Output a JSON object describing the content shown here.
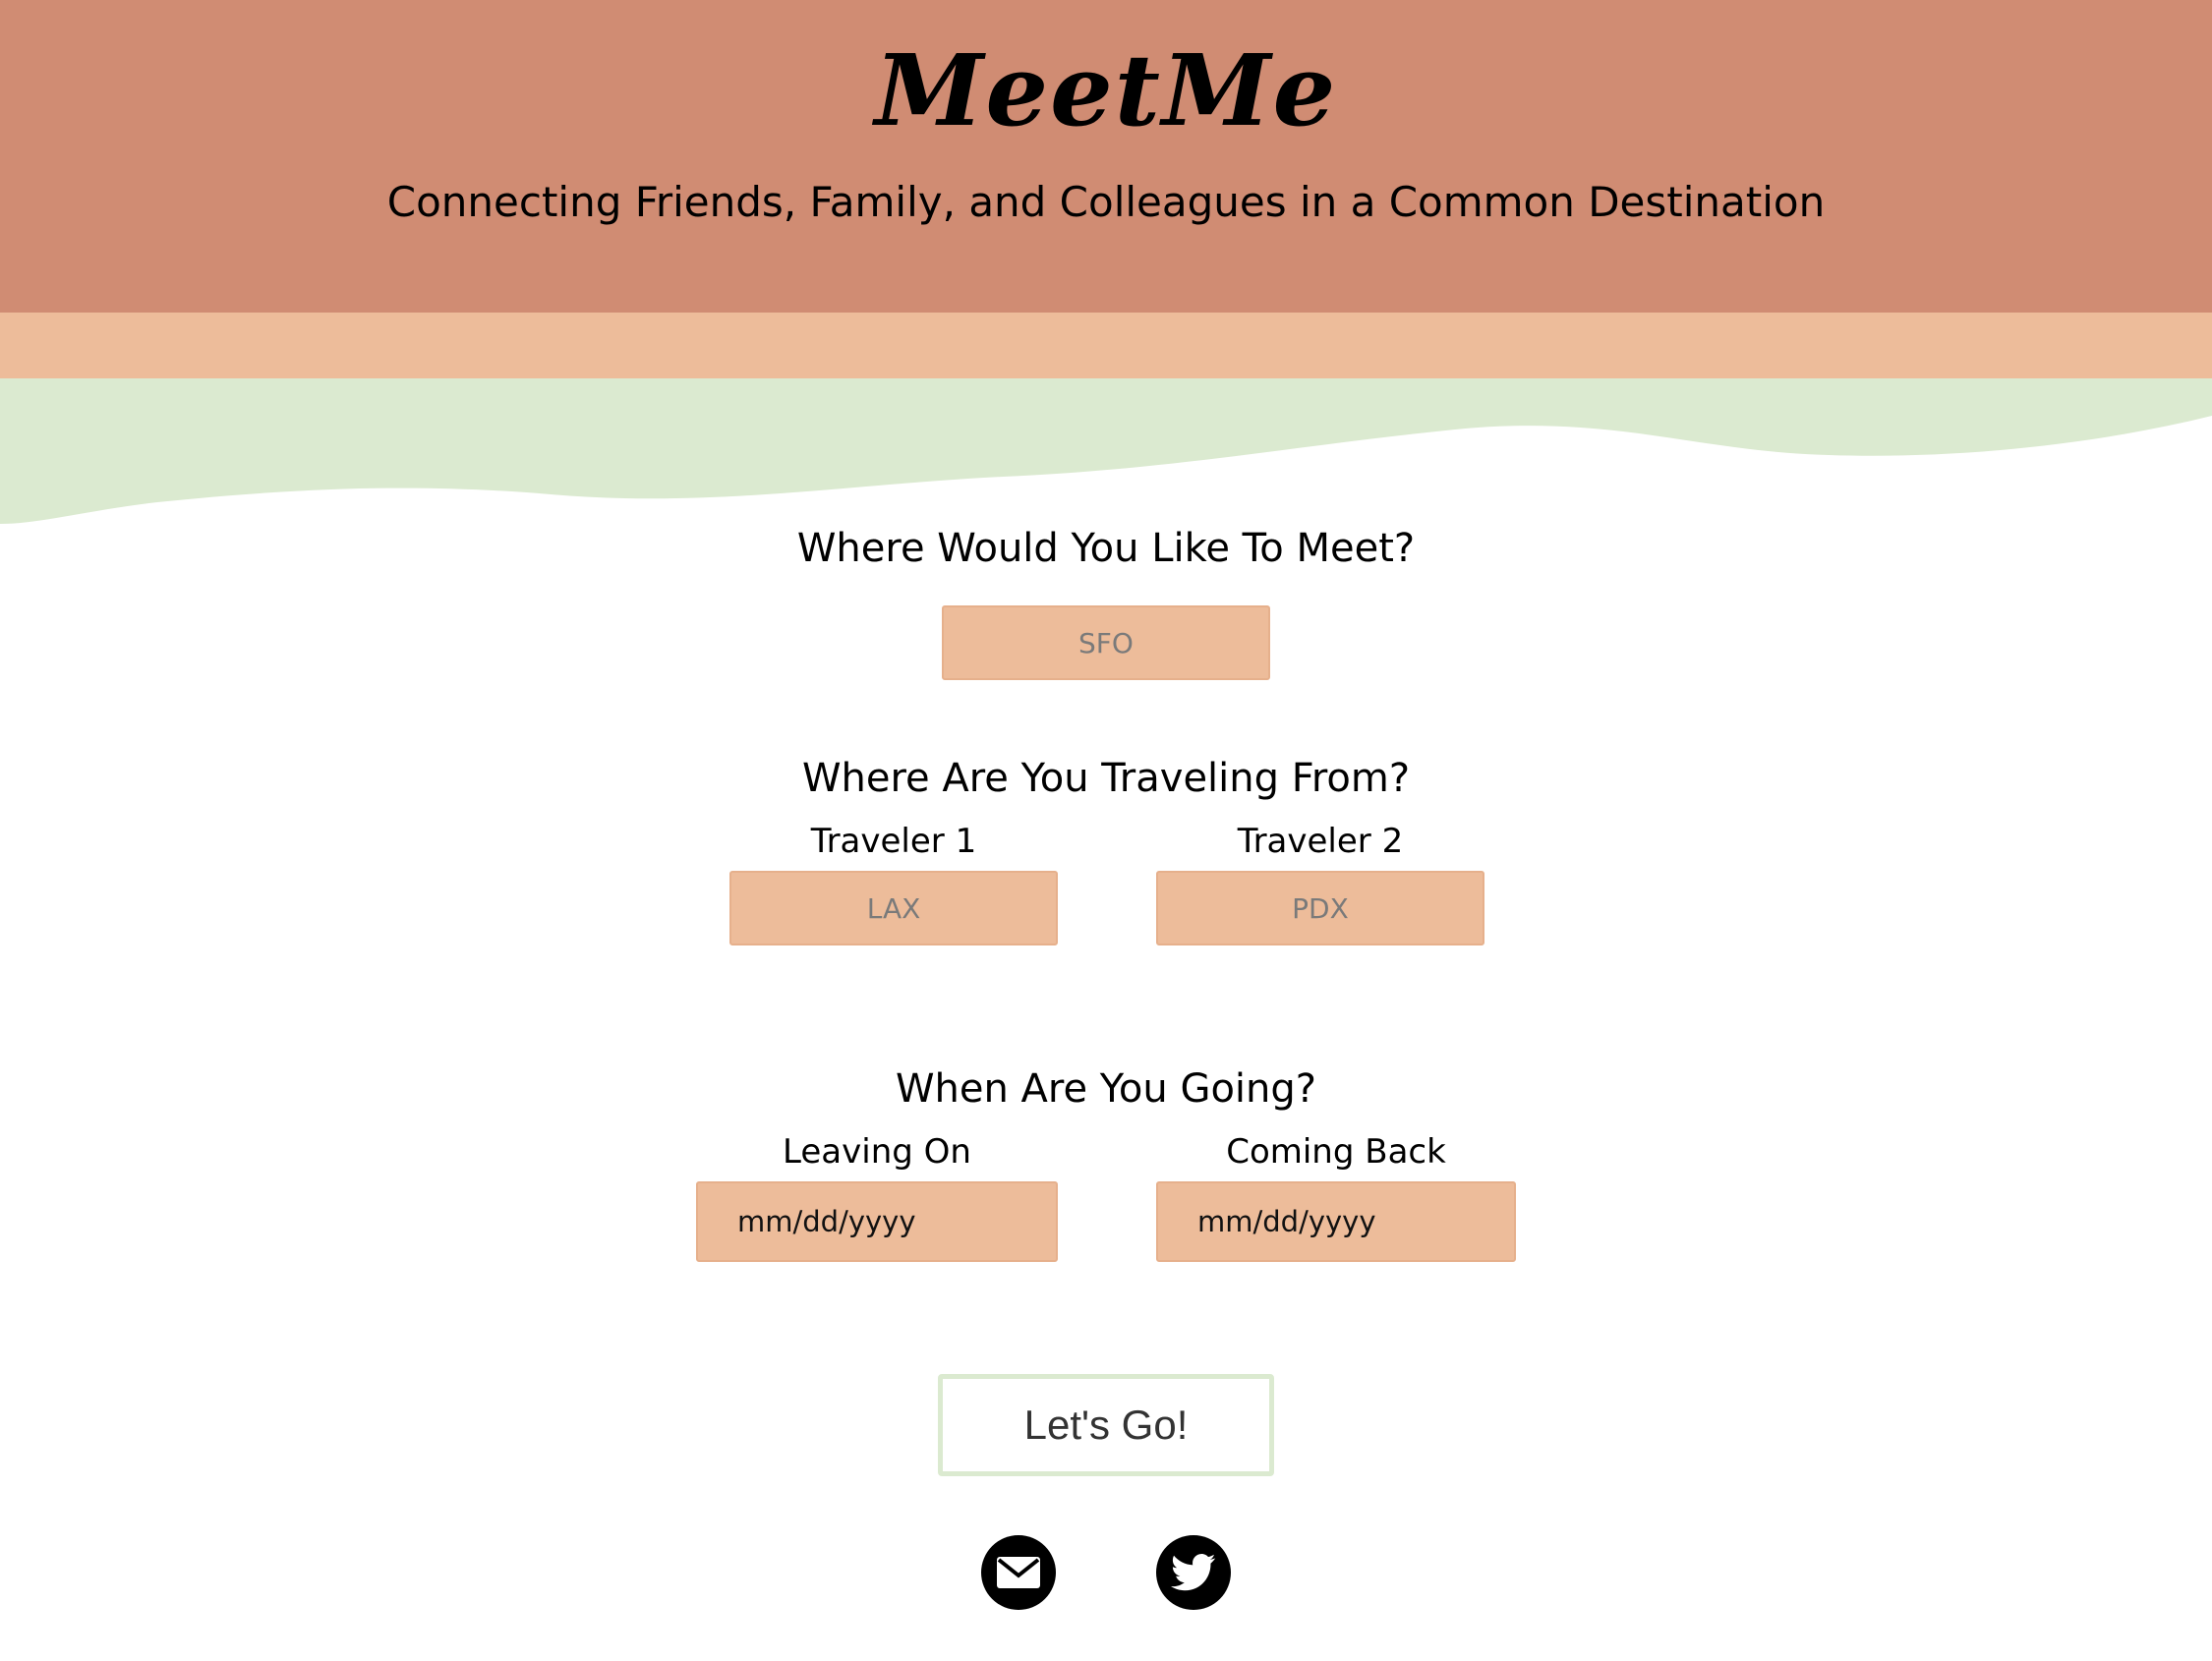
{
  "header": {
    "logo": "MeetMe",
    "tagline": "Connecting Friends, Family, and Colleagues in a Common Destination"
  },
  "destination": {
    "heading": "Where Would You Like To Meet?",
    "placeholder": "SFO"
  },
  "origins": {
    "heading": "Where Are You Traveling From?",
    "traveler1_label": "Traveler 1",
    "traveler1_placeholder": "LAX",
    "traveler2_label": "Traveler 2",
    "traveler2_placeholder": "PDX"
  },
  "dates": {
    "heading": "When Are You Going?",
    "leaving_label": "Leaving On",
    "leaving_value": "mm/dd/yyyy",
    "returning_label": "Coming Back",
    "returning_value": "mm/dd/yyyy"
  },
  "submit_label": "Let's Go!",
  "social": {
    "email_icon": "email-icon",
    "twitter_icon": "twitter-icon"
  },
  "colors": {
    "header": "#d08c73",
    "band": "#edbc9a",
    "wave": "#dbead0",
    "field": "#edbc9a",
    "button_border": "#dbead0"
  }
}
